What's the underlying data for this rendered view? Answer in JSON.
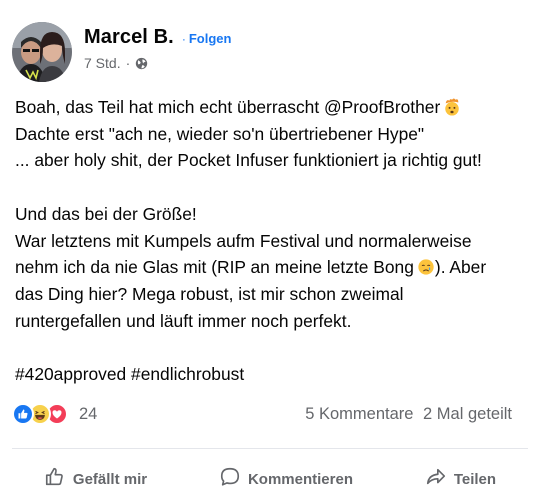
{
  "post": {
    "author": "Marcel B.",
    "dot": "·",
    "follow_label": "Folgen",
    "time": "7 Std.",
    "time_sep": "·",
    "audience_icon": "globe-icon",
    "lines": [
      "Boah, das Teil hat mich echt überrascht @ProofBrother",
      "Dachte erst \"ach ne, wieder so'n übertriebener Hype\"",
      "... aber holy shit, der Pocket Infuser funktioniert ja richtig gut!",
      "Und das bei der Größe!",
      "War letztens mit Kumpels aufm Festival und normalerweise",
      "nehm ich da nie Glas mit (RIP an meine letzte Bong",
      "). Aber",
      "das Ding hier? Mega robust, ist mir schon zweimal",
      "runtergefallen und läuft immer noch perfekt.",
      "#420approved #endlichrobust"
    ],
    "emojis": [
      "exploding-head-emoji",
      "crying-face-emoji"
    ]
  },
  "stats": {
    "reaction_icons": [
      "like-reaction-icon",
      "haha-reaction-icon",
      "love-reaction-icon"
    ],
    "reaction_count": "24",
    "comments": "5 Kommentare",
    "shares": "2 Mal geteilt"
  },
  "actions": {
    "like": "Gefällt mir",
    "comment": "Kommentieren",
    "share": "Teilen"
  },
  "colors": {
    "accent": "#1877f2",
    "secondary_text": "#65676b",
    "love": "#f33e58",
    "haha": "#f7d14c"
  }
}
